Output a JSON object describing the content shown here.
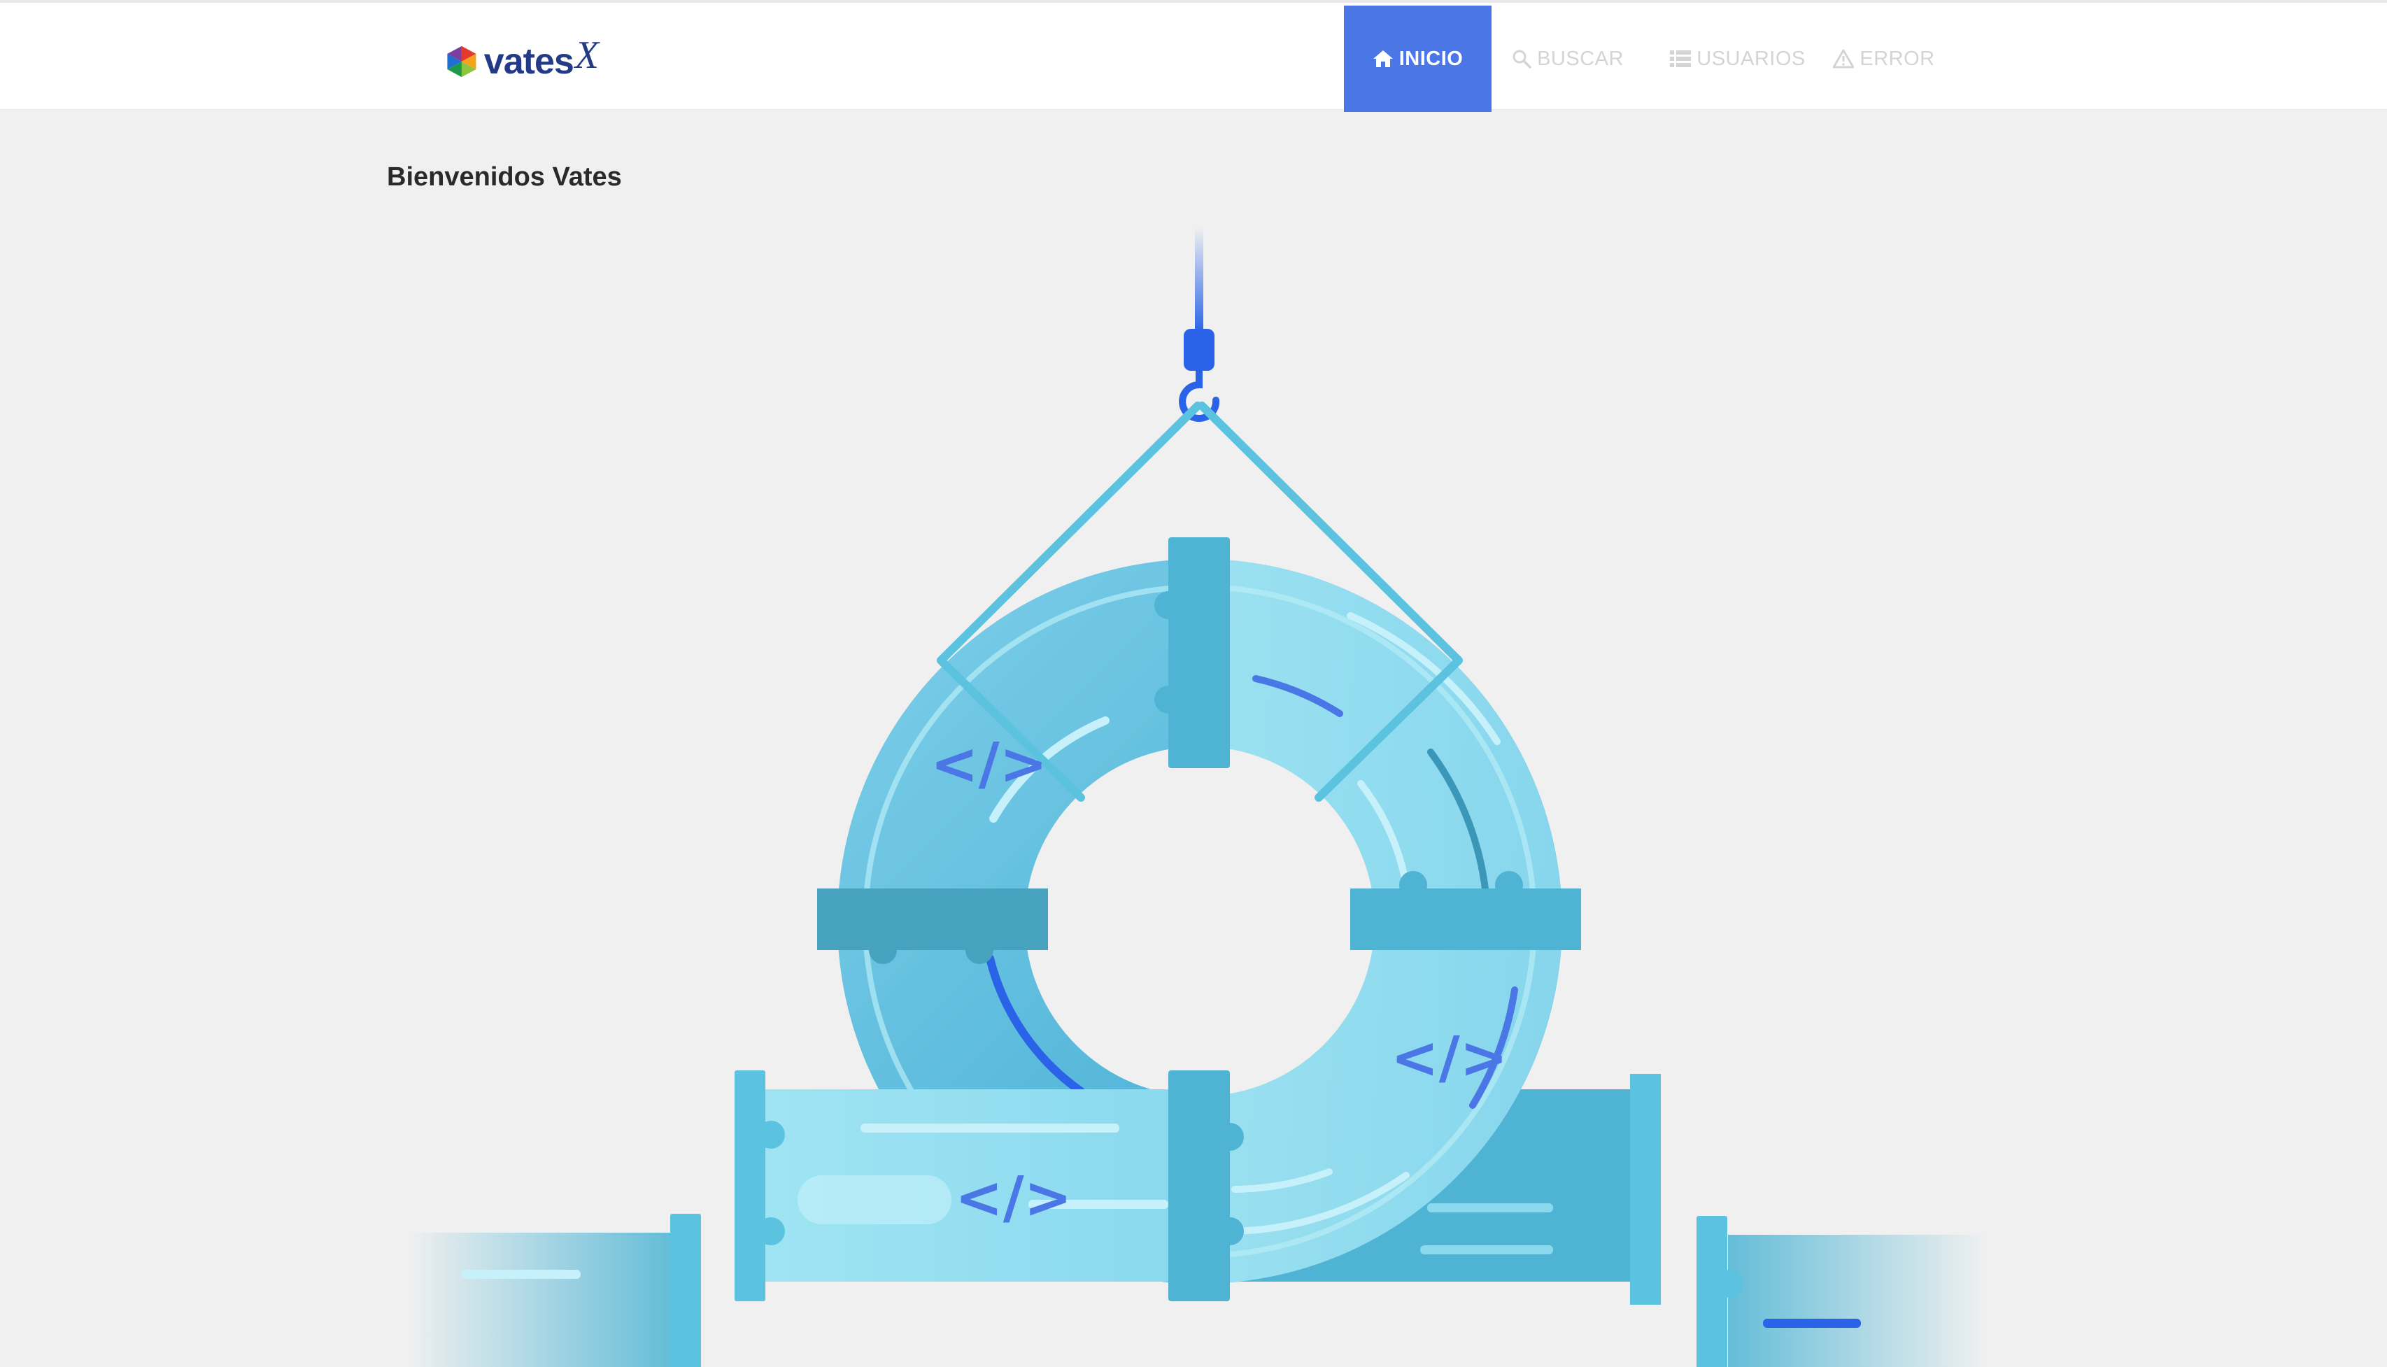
{
  "brand": {
    "name": "vates",
    "mark": "X"
  },
  "nav": {
    "items": [
      {
        "label": "INICIO",
        "icon": "home-icon",
        "active": true
      },
      {
        "label": "BUSCAR",
        "icon": "search-icon",
        "active": false
      },
      {
        "label": "USUARIOS",
        "icon": "list-icon",
        "active": false
      },
      {
        "label": "ERROR",
        "icon": "warning-icon",
        "active": false
      }
    ]
  },
  "main": {
    "title": "Bienvenidos Vates"
  },
  "illustration": {
    "code_symbol": "</>"
  },
  "colors": {
    "accent": "#4a77e5",
    "pipe_light": "#8fdcee",
    "pipe_mid": "#4fb6d6",
    "pipe_dark": "#3b97b8",
    "hook": "#2a63e8",
    "background": "#f0f0f0"
  }
}
